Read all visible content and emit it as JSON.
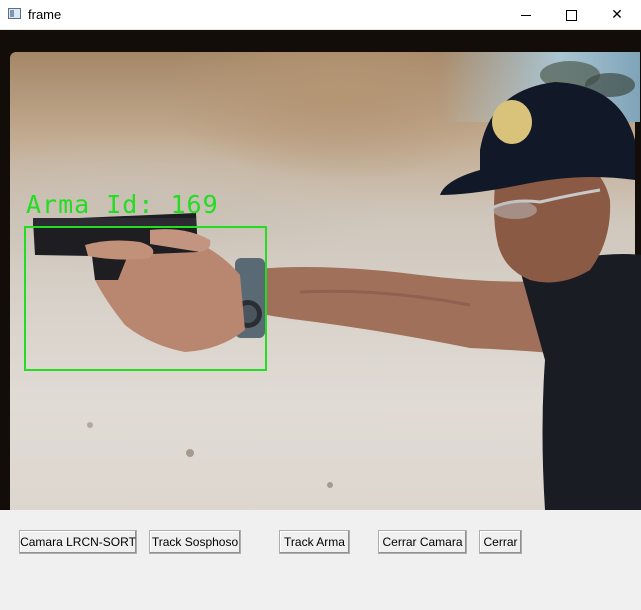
{
  "window": {
    "title": "frame",
    "minimize_icon": "minimize-icon",
    "maximize_icon": "maximize-icon",
    "close_glyph": "✕"
  },
  "video": {
    "detection_label": "Arma Id: 169",
    "box_color": "#22dd22"
  },
  "buttons": {
    "camera": "Camara LRCN-SORT",
    "track_suspect": "Track Sosphoso",
    "track_weapon": "Track Arma",
    "close_camera": "Cerrar Camara",
    "close": "Cerrar"
  }
}
